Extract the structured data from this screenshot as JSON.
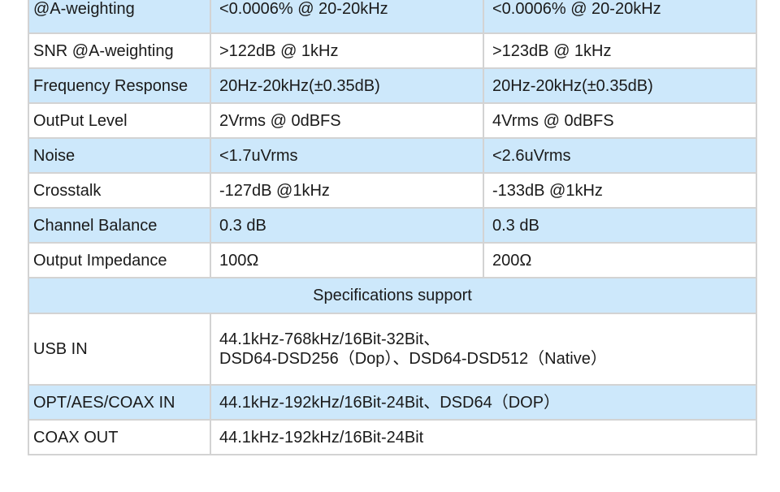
{
  "table": {
    "partial_row": {
      "label": "@A-weighting",
      "col1": "<0.0006% @ 20-20kHz",
      "col2": "<0.0006% @ 20-20kHz"
    },
    "rows": [
      {
        "label": "SNR @A-weighting",
        "col1": ">122dB @ 1kHz",
        "col2": ">123dB @ 1kHz"
      },
      {
        "label": "Frequency Response",
        "col1": "20Hz-20kHz(±0.35dB)",
        "col2": "20Hz-20kHz(±0.35dB)"
      },
      {
        "label": "OutPut Level",
        "col1": "2Vrms @ 0dBFS",
        "col2": "4Vrms @ 0dBFS"
      },
      {
        "label": "Noise",
        "col1": "<1.7uVrms",
        "col2": "<2.6uVrms"
      },
      {
        "label": "Crosstalk",
        "col1": "-127dB @1kHz",
        "col2": "-133dB @1kHz"
      },
      {
        "label": "Channel Balance",
        "col1": "0.3 dB",
        "col2": "0.3 dB"
      },
      {
        "label": "Output Impedance",
        "col1": "100Ω",
        "col2": "200Ω"
      }
    ],
    "section_header": "Specifications support",
    "support_rows": [
      {
        "label": "USB IN",
        "line1": "44.1kHz-768kHz/16Bit-32Bit、",
        "line2": "DSD64-DSD256（Dop）、DSD64-DSD512（Native）"
      },
      {
        "label": "OPT/AES/COAX IN",
        "value": "44.1kHz-192kHz/16Bit-24Bit、DSD64（DOP）"
      },
      {
        "label": "COAX OUT",
        "value": "44.1kHz-192kHz/16Bit-24Bit"
      }
    ]
  },
  "colors": {
    "row_blue": "#cde8fb",
    "row_white": "#ffffff",
    "border": "#d3d3d3"
  }
}
